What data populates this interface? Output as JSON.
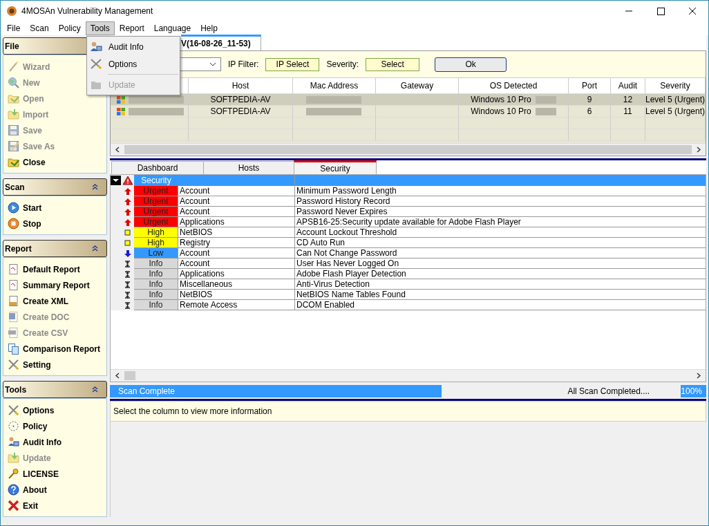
{
  "window": {
    "title": "4MOSAn Vulnerability Management"
  },
  "menu_bar": [
    {
      "label": "File",
      "selected": false
    },
    {
      "label": "Scan",
      "selected": false
    },
    {
      "label": "Policy",
      "selected": false
    },
    {
      "label": "Tools",
      "selected": true
    },
    {
      "label": "Report",
      "selected": false
    },
    {
      "label": "Language",
      "selected": false
    },
    {
      "label": "Help",
      "selected": false
    }
  ],
  "tools_menu": [
    {
      "label": "Audit Info",
      "disabled": false
    },
    {
      "label": "Options",
      "disabled": false
    },
    {
      "label": "Update",
      "disabled": true
    }
  ],
  "sidebar": {
    "groups": [
      {
        "title": "File",
        "items": [
          {
            "label": "Wizard",
            "disabled": true
          },
          {
            "label": "New",
            "disabled": true
          },
          {
            "label": "Open",
            "disabled": true
          },
          {
            "label": "Import",
            "disabled": true
          },
          {
            "label": "Save",
            "disabled": true
          },
          {
            "label": "Save As",
            "disabled": true
          },
          {
            "label": "Close",
            "disabled": false
          }
        ]
      },
      {
        "title": "Scan",
        "items": [
          {
            "label": "Start",
            "disabled": false
          },
          {
            "label": "Stop",
            "disabled": false
          }
        ]
      },
      {
        "title": "Report",
        "items": [
          {
            "label": "Default Report",
            "disabled": false
          },
          {
            "label": "Summary Report",
            "disabled": false
          },
          {
            "label": "Create XML",
            "disabled": false
          },
          {
            "label": "Create DOC",
            "disabled": true
          },
          {
            "label": "Create CSV",
            "disabled": true
          },
          {
            "label": "Comparison Report",
            "disabled": false
          },
          {
            "label": "Setting",
            "disabled": false
          }
        ]
      },
      {
        "title": "Tools",
        "items": [
          {
            "label": "Options",
            "disabled": false
          },
          {
            "label": "Policy",
            "disabled": false
          },
          {
            "label": "Audit Info",
            "disabled": false
          },
          {
            "label": "Update",
            "disabled": true
          },
          {
            "label": "LICENSE",
            "disabled": false
          },
          {
            "label": "About",
            "disabled": false
          },
          {
            "label": "Exit",
            "disabled": false
          }
        ]
      }
    ]
  },
  "document_tab": {
    "label": "V(16-08-26_11-53)"
  },
  "filter_bar": {
    "ip_filter_label": "IP Filter:",
    "ip_select": "IP Select",
    "severity_label": "Severity:",
    "severity_select": "Select",
    "ok_button": "Ok"
  },
  "hosts_table": {
    "columns": [
      "Host",
      "Mac Address",
      "Gateway",
      "OS Detected",
      "Port",
      "Audit",
      "Severity"
    ],
    "rows": [
      {
        "host": "SOFTPEDIA-AV",
        "os": "Windows 10 Pro",
        "port": "9",
        "audit": "12",
        "severity": "Level 5 (Urgent)",
        "selected": true
      },
      {
        "host": "SOFTPEDIA-AV",
        "os": "Windows 10 Pro",
        "port": "6",
        "audit": "11",
        "severity": "Level 5 (Urgent)",
        "selected": false
      }
    ]
  },
  "result_tabs": [
    {
      "label": "Dashboard",
      "selected": false
    },
    {
      "label": "Hosts",
      "selected": false
    },
    {
      "label": "Security",
      "selected": true
    }
  ],
  "findings": {
    "header": "Security",
    "rows": [
      {
        "kind": "urgent",
        "severity": "Urgent",
        "category": "Account",
        "description": "Minimum Password Length"
      },
      {
        "kind": "urgent",
        "severity": "Urgent",
        "category": "Account",
        "description": "Password History Record"
      },
      {
        "kind": "urgent",
        "severity": "Urgent",
        "category": "Account",
        "description": "Password Never Expires"
      },
      {
        "kind": "urgent",
        "severity": "Urgent",
        "category": "Applications",
        "description": "APSB16-25:Security update available for Adobe Flash Player"
      },
      {
        "kind": "high",
        "severity": "High",
        "category": "NetBIOS",
        "description": "Account Lockout Threshold"
      },
      {
        "kind": "high",
        "severity": "High",
        "category": "Registry",
        "description": "CD Auto Run"
      },
      {
        "kind": "low",
        "severity": "Low",
        "category": "Account",
        "description": "Can Not Change Password"
      },
      {
        "kind": "info",
        "severity": "Info",
        "category": "Account",
        "description": "User Has Never Logged On"
      },
      {
        "kind": "info",
        "severity": "Info",
        "category": "Applications",
        "description": "Adobe Flash Player Detection"
      },
      {
        "kind": "info",
        "severity": "Info",
        "category": "Miscellaneous",
        "description": "Anti-Virus Detection"
      },
      {
        "kind": "info",
        "severity": "Info",
        "category": "NetBIOS",
        "description": "NetBIOS Name Tables Found"
      },
      {
        "kind": "info",
        "severity": "Info",
        "category": "Remote Access",
        "description": "DCOM Enabled"
      }
    ]
  },
  "progress": {
    "label": "Scan Complete",
    "level": 0.73,
    "status": "All Scan Completed....",
    "percent": "100%"
  },
  "info_panel": {
    "text": "Select the column to view more information"
  }
}
